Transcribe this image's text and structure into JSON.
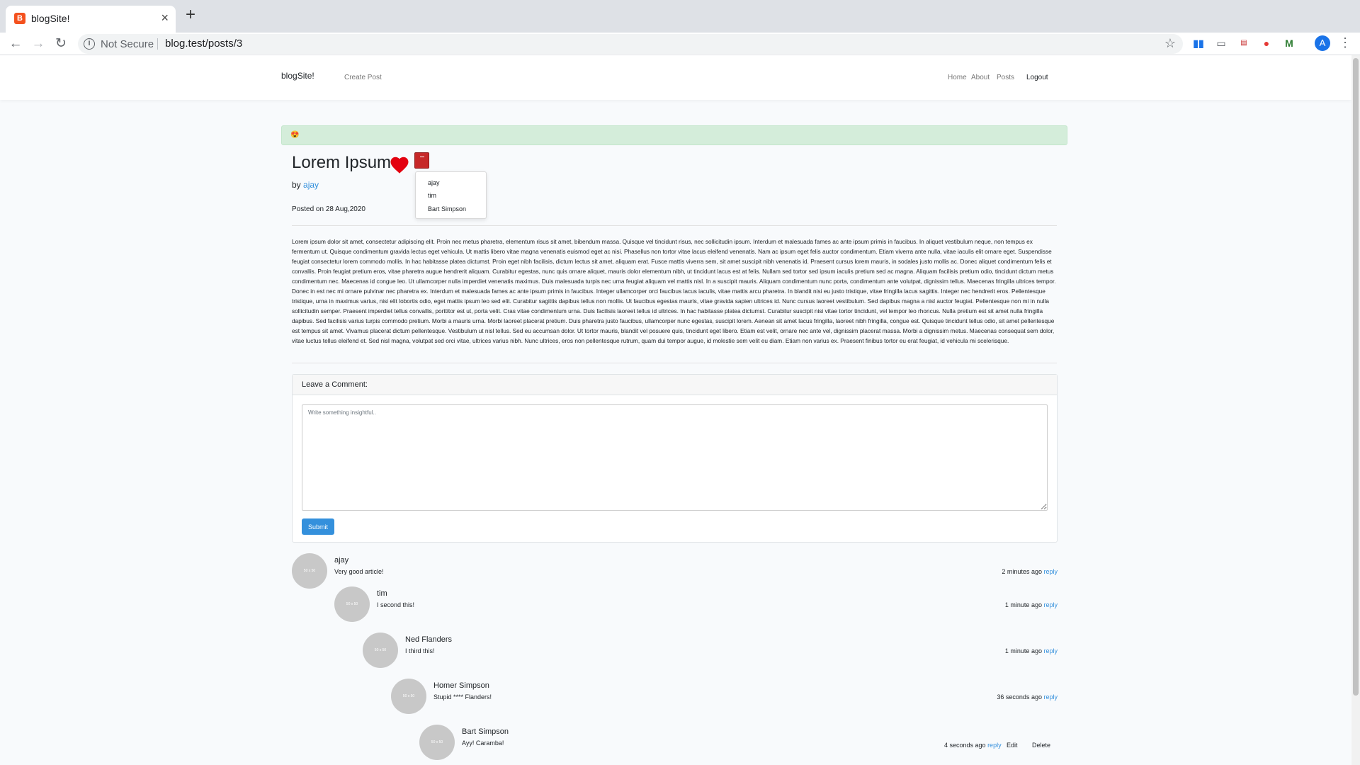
{
  "browser": {
    "tab_title": "blogSite!",
    "tab_favicon": "B",
    "new_tab": "+",
    "security_label": "Not Secure",
    "url": "blog.test/posts/3",
    "profile_initial": "A"
  },
  "navbar": {
    "brand": "blogSite!",
    "create_post": "Create Post",
    "home": "Home",
    "about": "About",
    "posts": "Posts",
    "logout": "Logout"
  },
  "alert": {
    "emoji": "😍"
  },
  "post": {
    "title": "Lorem Ipsum",
    "by_label": "by",
    "author": "ajay",
    "posted_on": "Posted on 28 Aug,2020",
    "body": "Lorem ipsum dolor sit amet, consectetur adipiscing elit. Proin nec metus pharetra, elementum risus sit amet, bibendum massa. Quisque vel tincidunt risus, nec sollicitudin ipsum. Interdum et malesuada fames ac ante ipsum primis in faucibus. In aliquet vestibulum neque, non tempus ex fermentum ut. Quisque condimentum gravida lectus eget vehicula. Ut mattis libero vitae magna venenatis euismod eget ac nisi. Phasellus non tortor vitae lacus eleifend venenatis. Nam ac ipsum eget felis auctor condimentum. Etiam viverra ante nulla, vitae iaculis elit ornare eget. Suspendisse feugiat consectetur lorem commodo mollis. In hac habitasse platea dictumst. Proin eget nibh facilisis, dictum lectus sit amet, aliquam erat. Fusce mattis viverra sem, sit amet suscipit nibh venenatis id. Praesent cursus lorem mauris, in sodales justo mollis ac. Donec aliquet condimentum felis et convallis. Proin feugiat pretium eros, vitae pharetra augue hendrerit aliquam. Curabitur egestas, nunc quis ornare aliquet, mauris dolor elementum nibh, ut tincidunt lacus est at felis. Nullam sed tortor sed ipsum iaculis pretium sed ac magna. Aliquam facilisis pretium odio, tincidunt dictum metus condimentum nec. Maecenas id congue leo. Ut ullamcorper nulla imperdiet venenatis maximus. Duis malesuada turpis nec urna feugiat aliquam vel mattis nisl. In a suscipit mauris. Aliquam condimentum nunc porta, condimentum ante volutpat, dignissim tellus. Maecenas fringilla ultrices tempor. Donec in est nec mi ornare pulvinar nec pharetra ex. Interdum et malesuada fames ac ante ipsum primis in faucibus. Integer ullamcorper orci faucibus lacus iaculis, vitae mattis arcu pharetra. In blandit nisi eu justo tristique, vitae fringilla lacus sagittis. Integer nec hendrerit eros. Pellentesque tristique, urna in maximus varius, nisi elit lobortis odio, eget mattis ipsum leo sed elit. Curabitur sagittis dapibus tellus non mollis. Ut faucibus egestas mauris, vitae gravida sapien ultrices id. Nunc cursus laoreet vestibulum. Sed dapibus magna a nisl auctor feugiat. Pellentesque non mi in nulla sollicitudin semper. Praesent imperdiet tellus convallis, porttitor est ut, porta velit. Cras vitae condimentum urna. Duis facilisis laoreet tellus id ultrices. In hac habitasse platea dictumst. Curabitur suscipit nisi vitae tortor tincidunt, vel tempor leo rhoncus. Nulla pretium est sit amet nulla fringilla dapibus. Sed facilisis varius turpis commodo pretium. Morbi a mauris urna. Morbi laoreet placerat pretium. Duis pharetra justo faucibus, ullamcorper nunc egestas, suscipit lorem. Aenean sit amet lacus fringilla, laoreet nibh fringilla, congue est. Quisque tincidunt tellus odio, sit amet pellentesque est tempus sit amet. Vivamus placerat dictum pellentesque. Vestibulum ut nisl tellus. Sed eu accumsan dolor. Ut tortor mauris, blandit vel posuere quis, tincidunt eget libero. Etiam est velit, ornare nec ante vel, dignissim placerat massa. Morbi a dignissim metus. Maecenas consequat sem dolor, vitae luctus tellus eleifend et. Sed nisl magna, volutpat sed orci vitae, ultrices varius nibh. Nunc ultrices, eros non pellentesque rutrum, quam dui tempor augue, id molestie sem velit eu diam. Etiam non varius ex. Praesent finibus tortor eu erat feugiat, id vehicula mi scelerisque."
  },
  "likes_dropdown": [
    "ajay",
    "tim",
    "Bart Simpson"
  ],
  "comment_form": {
    "header": "Leave a Comment:",
    "placeholder": "Write something insightful..",
    "submit": "Submit"
  },
  "comments": [
    {
      "name": "ajay",
      "text": "Very good article!",
      "time": "2 minutes ago",
      "reply": "reply",
      "avatar_text": "50 x 50"
    },
    {
      "name": "tim",
      "text": "I second this!",
      "time": "1 minute ago",
      "reply": "reply",
      "avatar_text": "50 x 50"
    },
    {
      "name": "Ned Flanders",
      "text": "I third this!",
      "time": "1 minute ago",
      "reply": "reply",
      "avatar_text": "50 x 50"
    },
    {
      "name": "Homer Simpson",
      "text": "Stupid **** Flanders!",
      "time": "36 seconds ago",
      "reply": "reply",
      "avatar_text": "50 x 50"
    },
    {
      "name": "Bart Simpson",
      "text": "Ayy! Caramba!",
      "time": "4 seconds ago",
      "reply": "reply",
      "edit": "Edit",
      "delete": "Delete",
      "avatar_text": "50 x 50"
    }
  ],
  "colors": {
    "link": "#3490dc",
    "like_button": "#c62828",
    "heart": "#e3000f",
    "alert_bg": "#d4edda"
  },
  "icons": [
    "back-icon",
    "forward-icon",
    "reload-icon",
    "info-icon",
    "star-icon",
    "heart-icon",
    "menu-dots-icon"
  ]
}
